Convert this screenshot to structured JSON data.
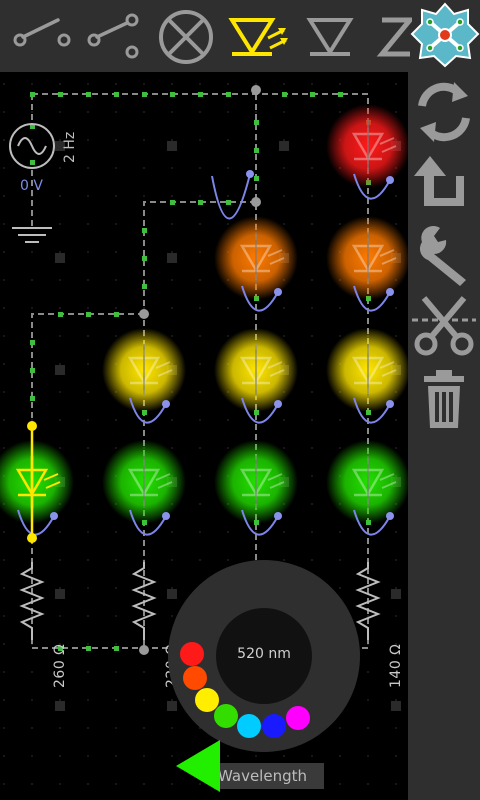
{
  "toolbar": {
    "tools": [
      {
        "icon": "switch-open-icon"
      },
      {
        "icon": "switch-spdt-icon"
      },
      {
        "icon": "lamp-icon"
      },
      {
        "icon": "led-icon",
        "selected": true
      },
      {
        "icon": "diode-icon"
      },
      {
        "icon": "zener-diode-icon"
      },
      {
        "icon": "app-logo-icon"
      }
    ],
    "selected_color": "#ffe600",
    "icon_color": "#9a9a9a"
  },
  "sidebar": {
    "buttons": [
      {
        "icon": "rotate-icon"
      },
      {
        "icon": "undo-icon"
      },
      {
        "icon": "wrench-icon"
      },
      {
        "icon": "cut-icon"
      },
      {
        "icon": "trash-icon"
      }
    ]
  },
  "source": {
    "frequency": "2 Hz",
    "voltage": "0 V"
  },
  "resistors": [
    {
      "label": "260 Ω"
    },
    {
      "label": "220 Ω"
    },
    {
      "label": "140 Ω"
    }
  ],
  "leds": {
    "colors": [
      "#ff1a1a",
      "#ff7a00",
      "#ffe600",
      "#22e000"
    ]
  },
  "wavelength_picker": {
    "value": "520 nm",
    "label": "Wavelength",
    "swatches": [
      {
        "color": "#ff1a1a"
      },
      {
        "color": "#ff4a00"
      },
      {
        "color": "#ffee00"
      },
      {
        "color": "#33dd00"
      },
      {
        "color": "#00ccff"
      },
      {
        "color": "#1a1aff"
      },
      {
        "color": "#ff00ff"
      }
    ],
    "arrow_color": "#22ee00"
  }
}
